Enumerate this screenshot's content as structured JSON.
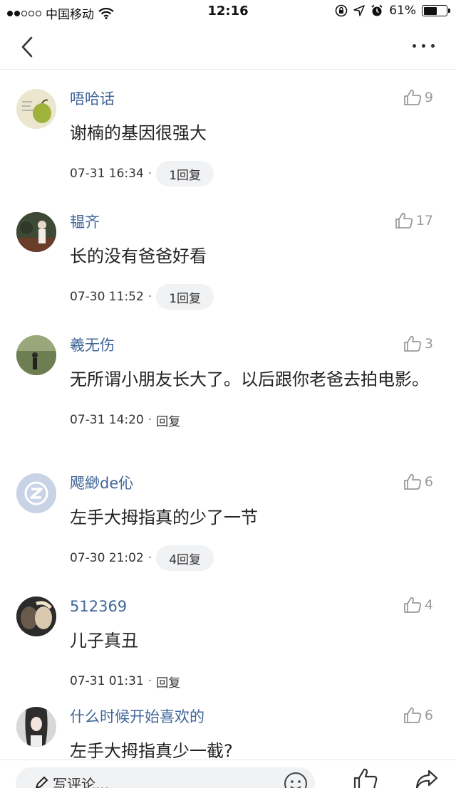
{
  "status_bar": {
    "carrier": "中国移动",
    "time": "12:16",
    "battery": "61%",
    "battery_level": 0.61
  },
  "comments": [
    {
      "username": "唔哈话",
      "likes": "9",
      "text": "谢楠的基因很强大",
      "time": "07-31 16:34",
      "reply": "1回复",
      "reply_style": "pill",
      "avatar_color": "#e9e2c8"
    },
    {
      "username": "韫齐",
      "likes": "17",
      "text": "长的没有爸爸好看",
      "time": "07-30 11:52",
      "reply": "1回复",
      "reply_style": "pill",
      "avatar_color": "#4a5a40"
    },
    {
      "username": "羲无伤",
      "likes": "3",
      "text": "无所谓小朋友长大了。以后跟你老爸去拍电影。",
      "time": "07-31 14:20",
      "reply": "回复",
      "reply_style": "plain",
      "avatar_color": "#5d7045"
    },
    {
      "username": "飔緲de伈",
      "likes": "6",
      "text": "左手大拇指真的少了一节",
      "time": "07-30 21:02",
      "reply": "4回复",
      "reply_style": "pill",
      "avatar_color": "#c9d3e6"
    },
    {
      "username": "512369",
      "likes": "4",
      "text": "儿子真丑",
      "time": "07-31 01:31",
      "reply": "回复",
      "reply_style": "plain",
      "avatar_color": "#3b3a3a"
    },
    {
      "username": "什么时候开始喜欢的",
      "likes": "6",
      "text": "左手大拇指真少一截?",
      "time": "",
      "reply": "",
      "reply_style": "plain",
      "avatar_color": "#cfcfcf"
    }
  ],
  "bottom_bar": {
    "placeholder": "写评论..."
  },
  "icons": {
    "back": "chevron-left-icon",
    "more": "more-dots-icon",
    "like": "thumbs-up-icon",
    "emoji": "emoji-icon",
    "share": "share-icon",
    "pen": "pen-icon"
  }
}
